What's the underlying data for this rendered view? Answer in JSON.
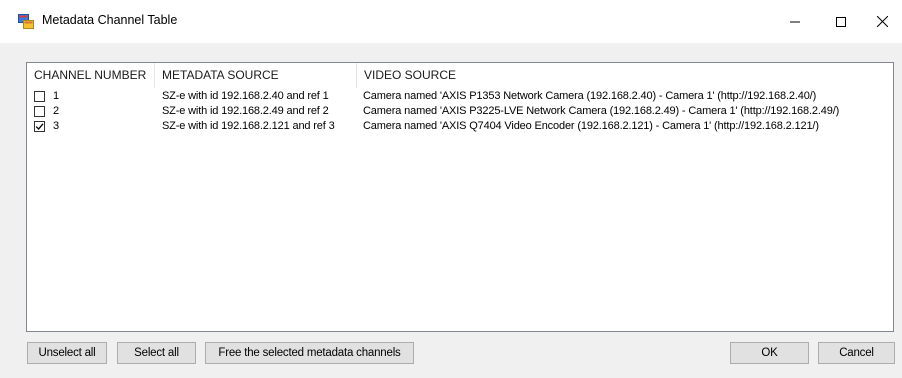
{
  "window": {
    "title": "Metadata Channel Table",
    "icon": "app-window-icon",
    "controls": [
      "minimize-icon",
      "maximize-icon",
      "close-icon"
    ]
  },
  "table": {
    "columns": [
      "CHANNEL NUMBER",
      "METADATA SOURCE",
      "VIDEO SOURCE"
    ],
    "rows": [
      {
        "checked": false,
        "channel": "1",
        "metadata_source": "SZ-e with id 192.168.2.40 and ref 1",
        "video_source": "Camera named 'AXIS P1353 Network Camera (192.168.2.40) - Camera 1' (http://192.168.2.40/)"
      },
      {
        "checked": false,
        "channel": "2",
        "metadata_source": "SZ-e with id 192.168.2.49 and ref 2",
        "video_source": "Camera named 'AXIS P3225-LVE Network Camera (192.168.2.49) - Camera 1' (http://192.168.2.49/)"
      },
      {
        "checked": true,
        "channel": "3",
        "metadata_source": "SZ-e with id 192.168.2.121 and ref 3",
        "video_source": "Camera named 'AXIS Q7404 Video Encoder (192.168.2.121) - Camera 1' (http://192.168.2.121/)"
      }
    ]
  },
  "buttons": {
    "unselect_all": "Unselect all",
    "select_all": "Select all",
    "free_selected": "Free the selected metadata channels",
    "ok": "OK",
    "cancel": "Cancel"
  }
}
